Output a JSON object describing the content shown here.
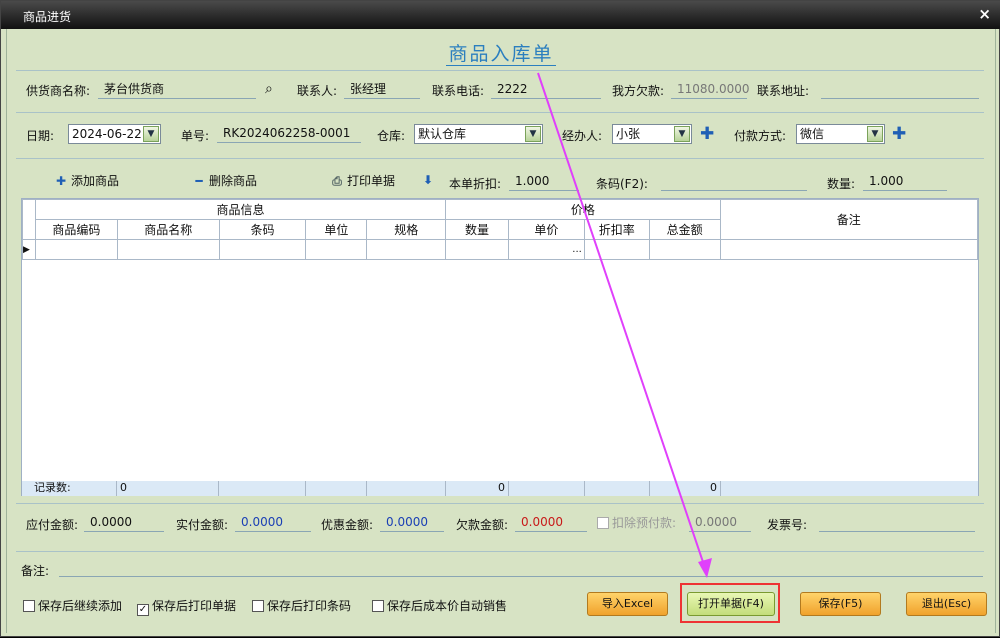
{
  "window": {
    "title": "商品进货",
    "close": "×"
  },
  "heading": "商品入库单",
  "row1": {
    "supplier_label": "供货商名称:",
    "supplier_value": "茅台供货商",
    "contact_label": "联系人:",
    "contact_value": "张经理",
    "phone_label": "联系电话:",
    "phone_value": "2222",
    "owed_label": "我方欠款:",
    "owed_value": "11080.0000",
    "address_label": "联系地址:",
    "address_value": ""
  },
  "row2": {
    "date_label": "日期:",
    "date_value": "2024-06-22",
    "order_label": "单号:",
    "order_value": "RK2024062258-0001",
    "warehouse_label": "仓库:",
    "warehouse_value": "默认仓库",
    "handler_label": "经办人:",
    "handler_value": "小张",
    "payment_label": "付款方式:",
    "payment_value": "微信"
  },
  "toolbar": {
    "add": "添加商品",
    "delete": "删除商品",
    "print": "打印单据",
    "discount_label": "本单折扣:",
    "discount_value": "1.000",
    "barcode_label": "条码(F2):",
    "barcode_value": "",
    "qty_label": "数量:",
    "qty_value": "1.000"
  },
  "grid": {
    "group_product": "商品信息",
    "group_price": "价格",
    "remark": "备注",
    "columns": [
      "商品编码",
      "商品名称",
      "条码",
      "单位",
      "规格",
      "数量",
      "单价",
      "折扣率",
      "总金额"
    ],
    "ellipsis": "...",
    "footer_label": "记录数:",
    "footer_count": "0",
    "footer_qty": "0",
    "footer_total": "0"
  },
  "totals": {
    "payable_label": "应付金额:",
    "payable_value": "0.0000",
    "paid_label": "实付金额:",
    "paid_value": "0.0000",
    "discount_label": "优惠金额:",
    "discount_value": "0.0000",
    "debt_label": "欠款金额:",
    "debt_value": "0.0000",
    "prepay_label": "扣除预付款:",
    "prepay_value": "0.0000",
    "invoice_label": "发票号:",
    "invoice_value": ""
  },
  "note_label": "备注:",
  "checkboxes": [
    {
      "label": "保存后继续添加",
      "checked": false
    },
    {
      "label": "保存后打印单据",
      "checked": true
    },
    {
      "label": "保存后打印条码",
      "checked": false
    },
    {
      "label": "保存后成本价自动销售",
      "checked": false
    }
  ],
  "buttons": {
    "import": "导入Excel",
    "open": "打开单据(F4)",
    "save": "保存(F5)",
    "exit": "退出(Esc)"
  },
  "colors": {
    "heading": "#2b7fbf",
    "annotation": "#e040fb",
    "highlight": "#e33333"
  }
}
